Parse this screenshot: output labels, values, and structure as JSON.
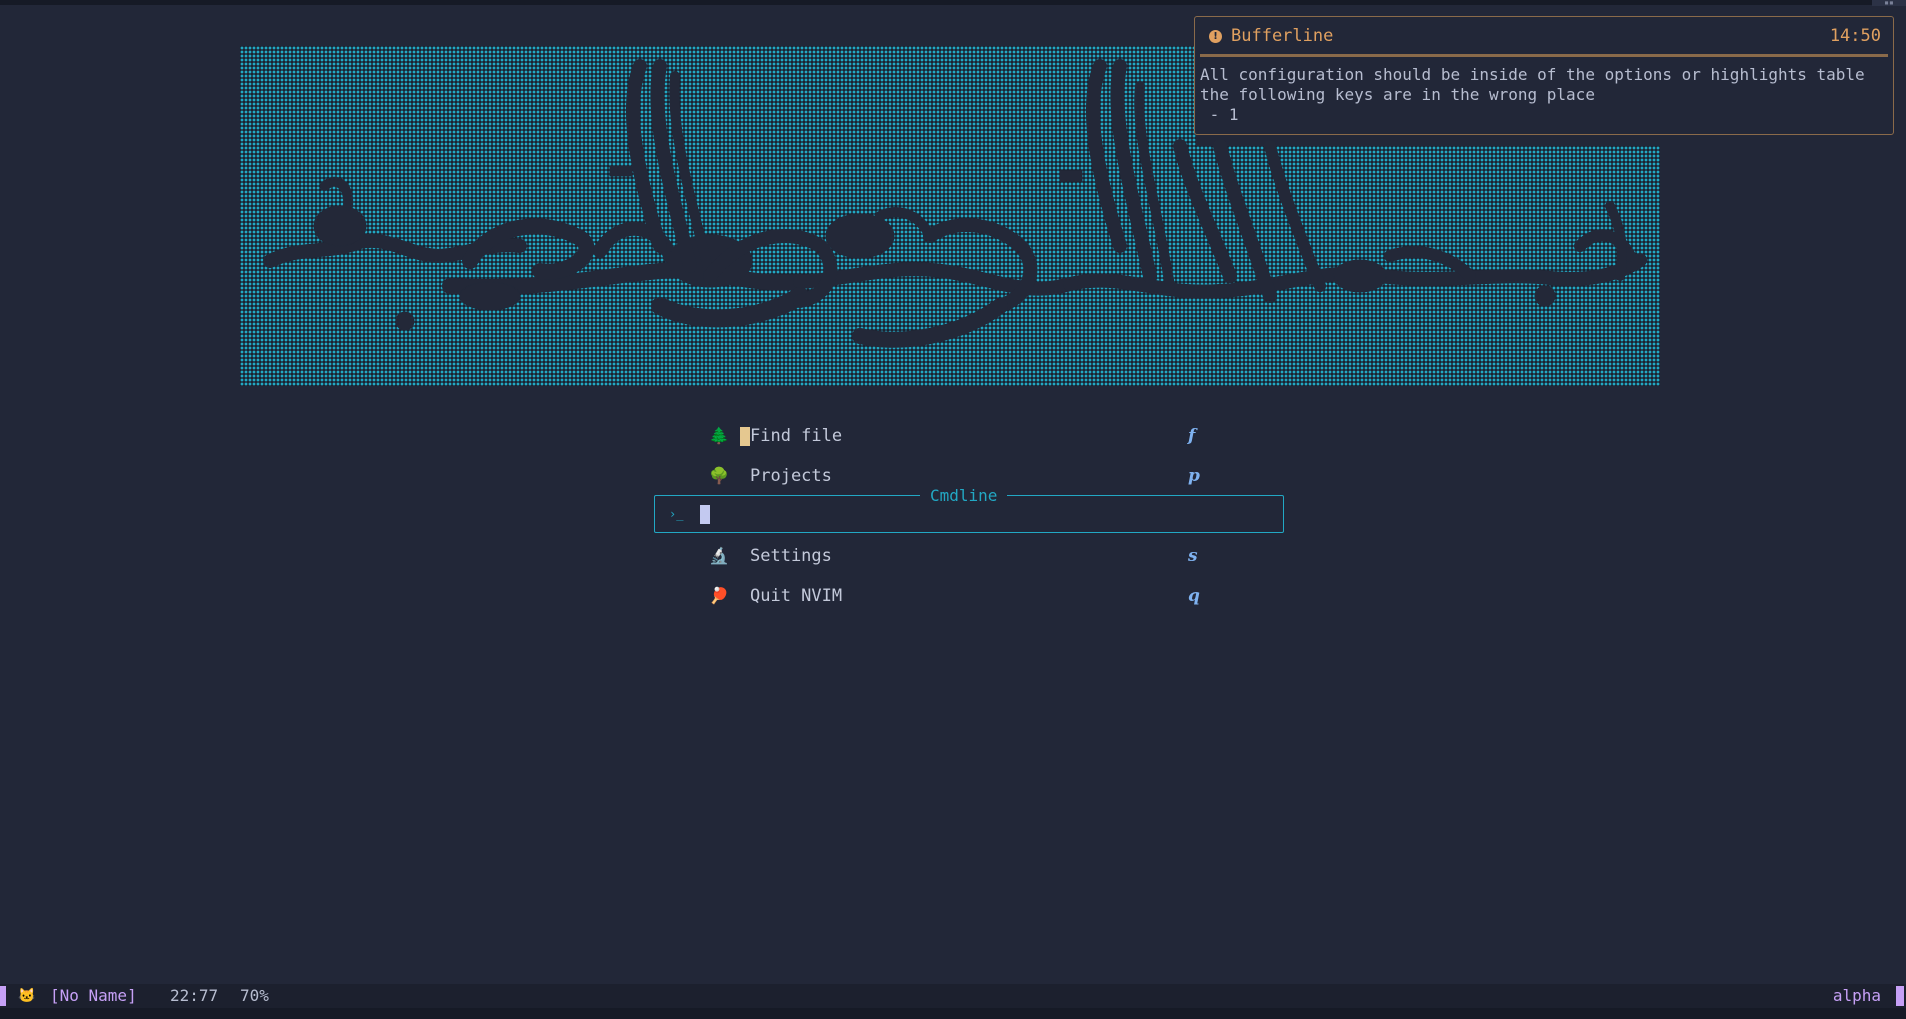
{
  "colors": {
    "background": "#222738",
    "banner_dots": "#22a8c4",
    "accent_cyan": "#22a8c4",
    "notify_warn": "#e0a060",
    "key_blue": "#7fb2f0",
    "status_purple": "#c6a0f6"
  },
  "banner": {
    "icon": "arabic-calligraphy-art"
  },
  "notification": {
    "icon": "warning-icon",
    "title": "Bufferline",
    "time": "14:50",
    "body": "All configuration should be inside of the options or highlights table\nthe following keys are in the wrong place\n - 1"
  },
  "dashboard": {
    "items": [
      {
        "icon": "tree-icon",
        "glyph": "🌲",
        "label": "Find file",
        "key": "f"
      },
      {
        "icon": "deciduous-tree-icon",
        "glyph": "🌳",
        "label": "Projects",
        "key": "p"
      },
      {
        "icon": "microscope-icon",
        "glyph": "🔬",
        "label": "Settings",
        "key": "s"
      },
      {
        "icon": "pingpong-icon",
        "glyph": "🏓",
        "label": "Quit NVIM",
        "key": "q"
      }
    ]
  },
  "cmdline": {
    "title": "Cmdline",
    "prompt": "›_",
    "value": ""
  },
  "statusline": {
    "mode_icon": "cat-icon",
    "file": "[No Name]",
    "position": "22:77",
    "percent": "70%",
    "filetype": "alpha"
  }
}
